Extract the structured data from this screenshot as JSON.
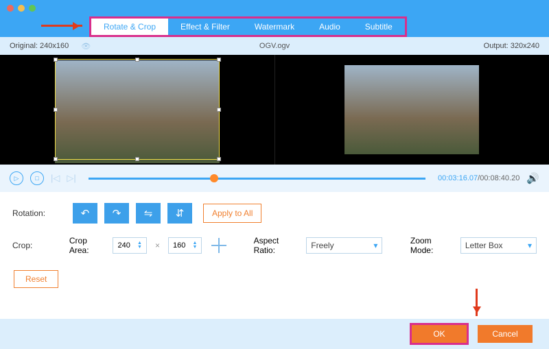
{
  "tabs": {
    "items": [
      {
        "label": "Rotate & Crop",
        "active": true
      },
      {
        "label": "Effect & Filter",
        "active": false
      },
      {
        "label": "Watermark",
        "active": false
      },
      {
        "label": "Audio",
        "active": false
      },
      {
        "label": "Subtitle",
        "active": false
      }
    ]
  },
  "info": {
    "original": "Original: 240x160",
    "filename": "OGV.ogv",
    "output": "Output: 320x240"
  },
  "playback": {
    "current": "00:03:16.07",
    "total": "/00:08:40.20"
  },
  "rotation": {
    "label": "Rotation:",
    "apply": "Apply to All"
  },
  "crop": {
    "label": "Crop:",
    "area_label": "Crop Area:",
    "width": "240",
    "height": "160",
    "aspect_label": "Aspect Ratio:",
    "aspect_value": "Freely",
    "zoom_label": "Zoom Mode:",
    "zoom_value": "Letter Box",
    "reset": "Reset"
  },
  "footer": {
    "ok": "OK",
    "cancel": "Cancel"
  }
}
